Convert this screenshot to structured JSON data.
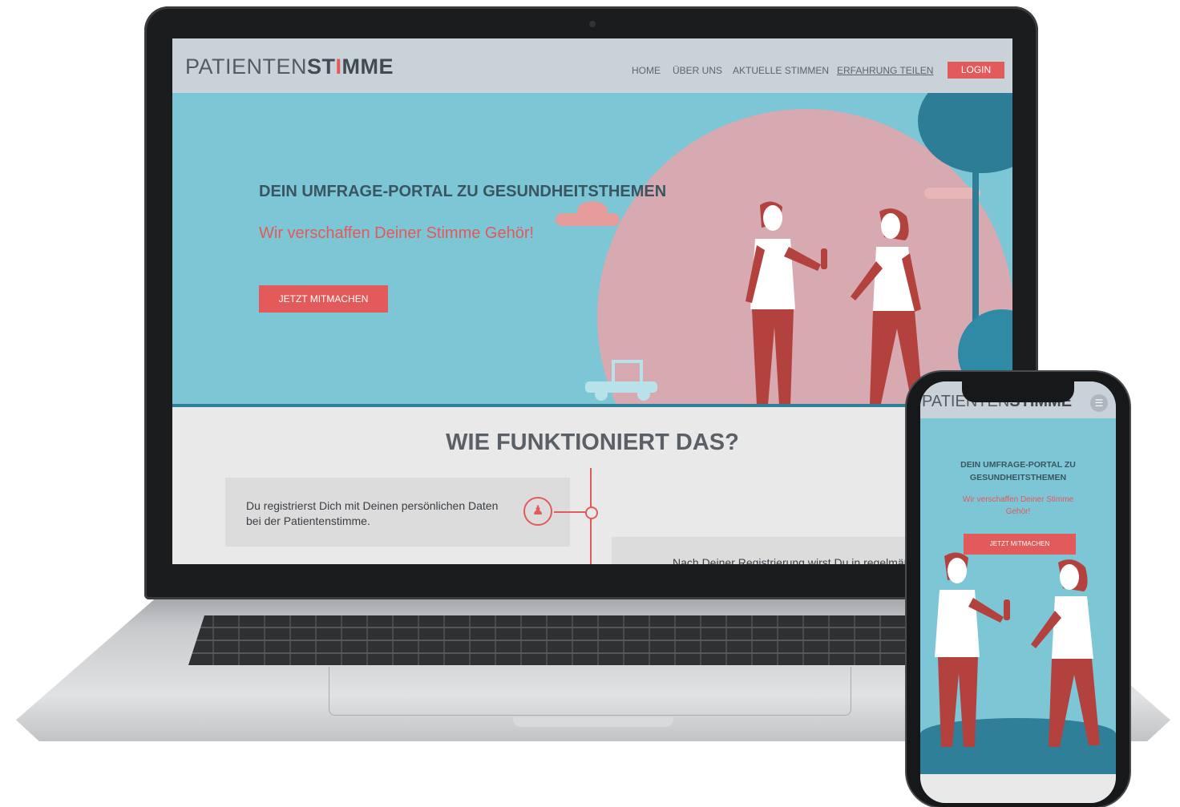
{
  "site": {
    "logo_light": "PATIENTEN",
    "logo_bold_a": "ST",
    "logo_bold_i": "I",
    "logo_bold_b": "MME"
  },
  "nav": {
    "items": [
      "HOME",
      "ÜBER UNS",
      "AKTUELLE STIMMEN",
      "ERFAHRUNG TEILEN"
    ],
    "active_item": "ERFAHRUNG TEILEN",
    "login": "LOGIN"
  },
  "hero": {
    "title": "DEIN UMFRAGE-PORTAL ZU GESUNDHEITSTHEMEN",
    "subtitle": "Wir verschaffen Deiner Stimme Gehör!",
    "cta": "JETZT MITMACHEN"
  },
  "how": {
    "title": "WIE FUNKTIONIERT DAS?",
    "step1": "Du registrierst Dich mit Deinen persönlichen Daten bei der Patientenstimme.",
    "step2_partial": "Nach Deiner Registrierung wirst Du in regelmäß"
  },
  "mobile": {
    "logo_light": "PATIENTEN",
    "logo_bold": "STIMME",
    "title": "DEIN UMFRAGE-PORTAL ZU GESUNDHEITSTHEMEN",
    "subtitle": "Wir verschaffen Deiner Stimme Gehör!",
    "cta": "JETZT MITMACHEN"
  },
  "colors": {
    "accent": "#e25a5a",
    "hero_bg": "#7cc6d5",
    "nav_bg": "#c9d1d9",
    "dark_teal": "#2d7d96",
    "pink": "#d7a9b1"
  }
}
